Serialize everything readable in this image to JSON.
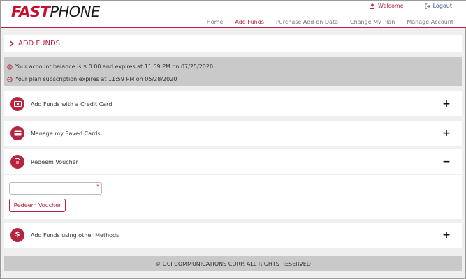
{
  "brand": {
    "logo_part1": "FAST",
    "logo_part2": "PHONE",
    "accent": "#b5263e"
  },
  "top_links": {
    "welcome": "Welcome",
    "logout": "Logout"
  },
  "nav": {
    "items": [
      {
        "label": "Home"
      },
      {
        "label": "Add Funds"
      },
      {
        "label": "Purchase Add-on Data"
      },
      {
        "label": "Change My Plan"
      },
      {
        "label": "Manage Account"
      }
    ],
    "active": "Add Funds"
  },
  "page_title": "ADD FUNDS",
  "info": {
    "balance": "Your account balance is $ 0.00 and expires at 11.59 PM on 07/25/2020",
    "subscription": "Your plan subscription expires at 11:59 PM on 05/28/2020"
  },
  "accordion": {
    "credit_card": {
      "label": "Add Funds with a Credit Card",
      "toggle": "+",
      "icon": "cash-icon"
    },
    "saved_cards": {
      "label": "Manage my Saved Cards",
      "toggle": "+",
      "icon": "card-icon"
    },
    "voucher": {
      "label": "Redeem Voucher",
      "toggle": "−",
      "icon": "document-icon",
      "input_value": "",
      "input_placeholder": "",
      "required_mark": "*",
      "button_label": "Redeem Voucher"
    },
    "other_methods": {
      "label": "Add Funds using other Methods",
      "toggle": "+",
      "icon": "dollar-icon"
    }
  },
  "footer": "© GCI COMMUNICATIONS CORP. ALL RIGHTS RESERVED"
}
